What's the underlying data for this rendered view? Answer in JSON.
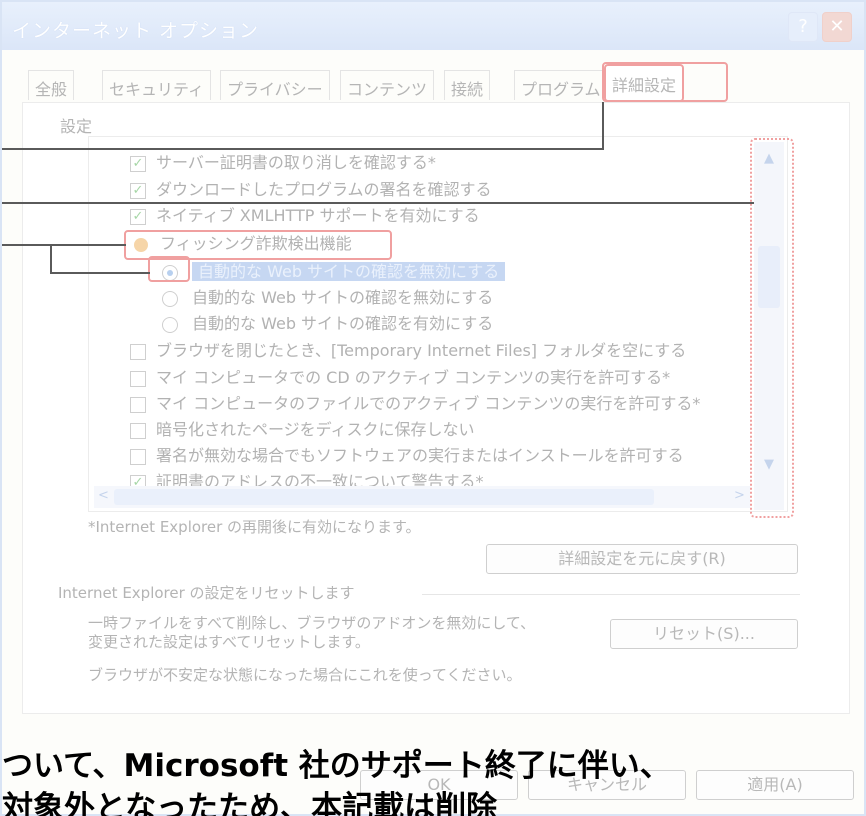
{
  "window": {
    "title": "インターネット オプション",
    "help_glyph": "?",
    "close_glyph": "✕"
  },
  "tabs": [
    {
      "label": "全般"
    },
    {
      "label": "セキュリティ"
    },
    {
      "label": "プライバシー"
    },
    {
      "label": "コンテンツ"
    },
    {
      "label": "接続"
    },
    {
      "label": "プログラム"
    },
    {
      "label": "詳細設定",
      "active": true
    }
  ],
  "settings": {
    "heading": "設定",
    "items": [
      {
        "text": "サーバー証明書の取り消しを確認する*",
        "type": "checkbox",
        "checked": true
      },
      {
        "text": "ダウンロードしたプログラムの署名を確認する",
        "type": "checkbox",
        "checked": true
      },
      {
        "text": "ネイティブ XMLHTTP サポートを有効にする",
        "type": "checkbox",
        "checked": true
      },
      {
        "text": "フィッシング詐欺検出機能",
        "type": "group"
      },
      {
        "text": "自動的な Web サイトの確認を無効にする",
        "type": "radio",
        "checked": true,
        "selected": true
      },
      {
        "text": "自動的な Web サイトの確認を無効にする",
        "type": "radio",
        "checked": false
      },
      {
        "text": "自動的な Web サイトの確認を有効にする",
        "type": "radio",
        "checked": false
      },
      {
        "text": "ブラウザを閉じたとき、[Temporary Internet Files] フォルダを空にする",
        "type": "checkbox",
        "checked": false
      },
      {
        "text": "マイ コンピュータでの CD のアクティブ コンテンツの実行を許可する*",
        "type": "checkbox",
        "checked": false
      },
      {
        "text": "マイ コンピュータのファイルでのアクティブ コンテンツの実行を許可する*",
        "type": "checkbox",
        "checked": false
      },
      {
        "text": "暗号化されたページをディスクに保存しない",
        "type": "checkbox",
        "checked": false
      },
      {
        "text": "署名が無効な場合でもソフトウェアの実行またはインストールを許可する",
        "type": "checkbox",
        "checked": false
      },
      {
        "text": "証明書のアドレスの不一致について警告する*",
        "type": "checkbox",
        "checked": true
      }
    ],
    "check_glyph": "✓"
  },
  "scroll": {
    "up": "▲",
    "down": "▼",
    "left": "<",
    "right": ">"
  },
  "note": "*Internet Explorer の再開後に有効になります。",
  "restore_button": "詳細設定を元に戻す(R)",
  "reset_group": {
    "label": "Internet Explorer の設定をリセットします",
    "description_line1": "一時ファイルをすべて削除し、ブラウザのアドオンを無効にして、",
    "description_line2": "変更された設定はすべてリセットします。",
    "reset_button": "リセット(S)...",
    "hint": "ブラウザが不安定な状態になった場合にこれを使ってください。"
  },
  "footer": {
    "ok": "OK",
    "cancel": "キャンセル",
    "apply": "適用(A)"
  },
  "overlay": {
    "line1": "ついて、Microsoft 社のサポート終了に伴い、",
    "line2": "対象外となったため、本記載は削除"
  }
}
